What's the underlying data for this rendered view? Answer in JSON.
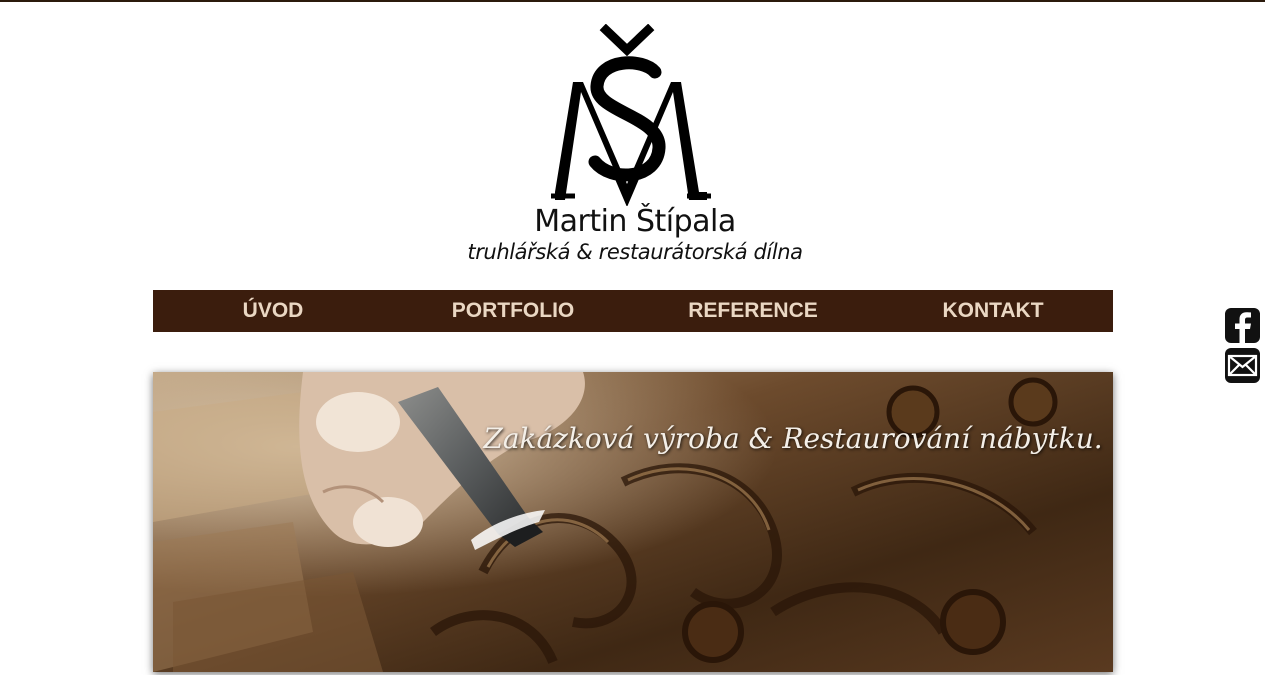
{
  "logo": {
    "monogram": "MŠ",
    "name": "Martin Štípala",
    "tagline": "truhlářská & restaurátorská dílna"
  },
  "nav": {
    "items": [
      {
        "label": "ÚVOD"
      },
      {
        "label": "PORTFOLIO"
      },
      {
        "label": "REFERENCE"
      },
      {
        "label": "KONTAKT"
      }
    ]
  },
  "social": {
    "facebook_icon": "facebook-icon",
    "mail_icon": "envelope-icon"
  },
  "hero": {
    "caption": "Zakázková výroba & Restaurování nábytku."
  },
  "colors": {
    "nav_background": "#3b1d0d",
    "nav_text": "#ead7c3",
    "top_line": "#2b1a0c"
  }
}
